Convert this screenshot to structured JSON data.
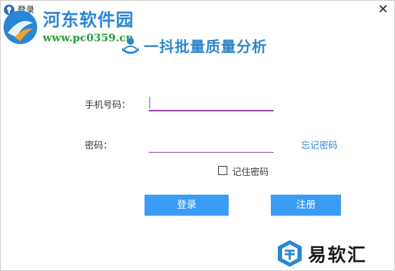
{
  "window": {
    "title": "登录"
  },
  "watermark": {
    "name": "河东软件园",
    "url": "www.pc0359.cn"
  },
  "brand": {
    "name": "一抖批量质量分析"
  },
  "form": {
    "phone_label": "手机号码：",
    "phone_value": "",
    "password_label": "密码：",
    "password_value": "",
    "forgot_label": "忘记密码",
    "remember_label": "记住密码",
    "remember_checked": false
  },
  "buttons": {
    "login": "登录",
    "register": "注册"
  },
  "corner_brand": {
    "name": "易软汇"
  },
  "colors": {
    "accent": "#3b9cf5",
    "link": "#2a86d6",
    "input_underline": "#8e3fa1"
  }
}
